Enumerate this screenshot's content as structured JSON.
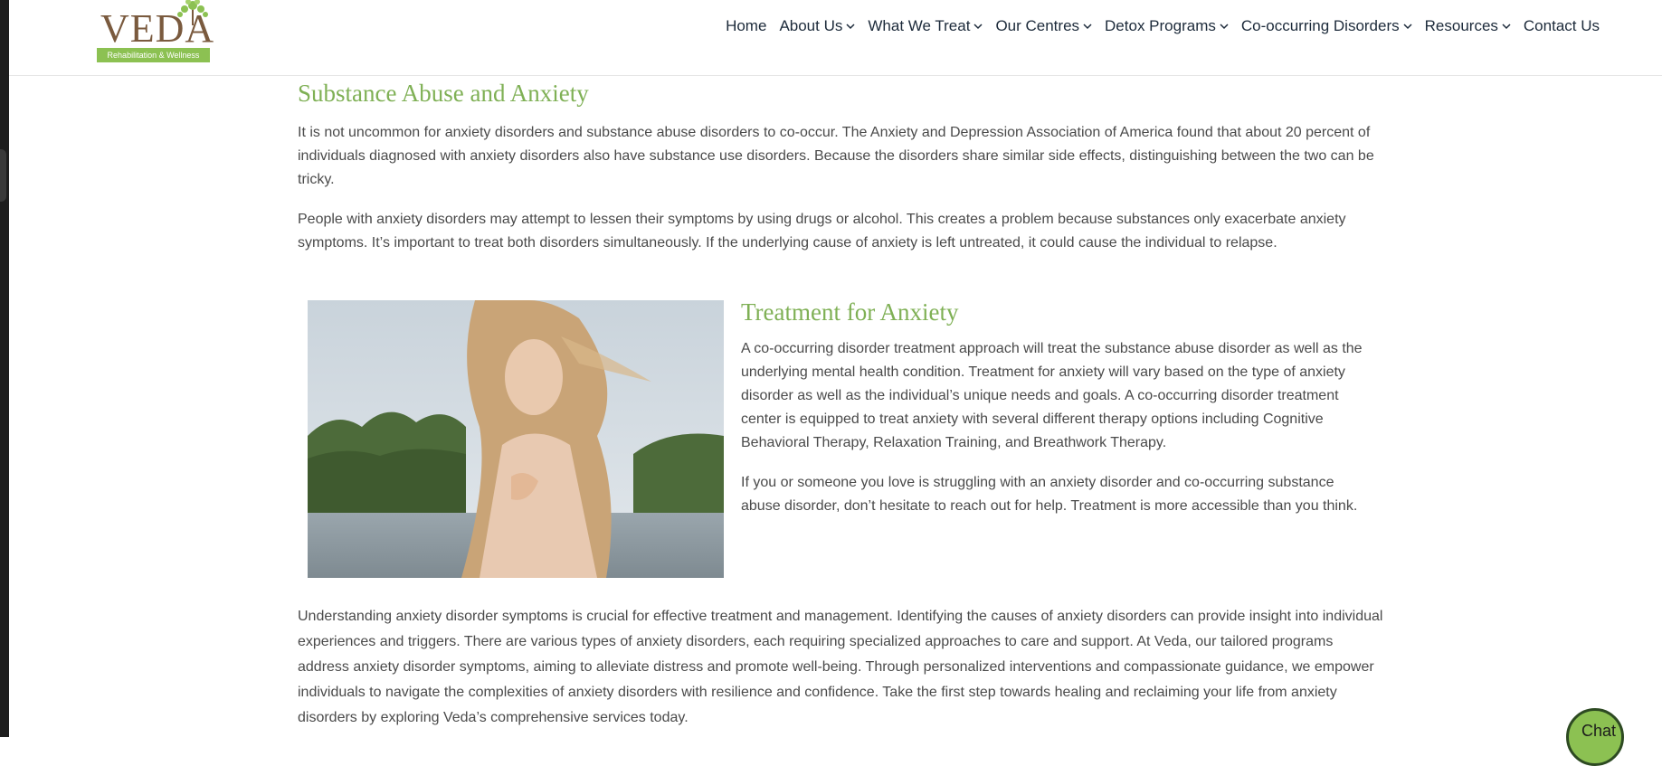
{
  "logo": {
    "word": "VEDA",
    "tagline": "Rehabilitation & Wellness"
  },
  "nav": {
    "items": [
      {
        "label": "Home",
        "dropdown": false
      },
      {
        "label": "About Us",
        "dropdown": true
      },
      {
        "label": "What We Treat",
        "dropdown": true
      },
      {
        "label": "Our Centres",
        "dropdown": true
      },
      {
        "label": "Detox Programs",
        "dropdown": true
      },
      {
        "label": "Co-occurring Disorders",
        "dropdown": true
      },
      {
        "label": "Resources",
        "dropdown": true
      },
      {
        "label": "Contact Us",
        "dropdown": false
      }
    ]
  },
  "section1": {
    "title": "Substance Abuse and Anxiety",
    "paragraphs": [
      "It is not uncommon for anxiety disorders and substance abuse disorders to co-occur. The Anxiety and Depression Association of America found that about 20 percent of individuals diagnosed with anxiety disorders also have substance use disorders. Because the disorders share similar side effects, distinguishing between the two can be tricky.",
      "People with anxiety disorders may attempt to lessen their symptoms by using drugs or alcohol. This creates a problem because substances only exacerbate anxiety symptoms. It’s important to treat both disorders simultaneously. If the underlying cause of anxiety is left untreated, it could cause the individual to relapse."
    ]
  },
  "section2": {
    "title": "Treatment for Anxiety",
    "paragraphs": [
      "A co-occurring disorder treatment approach will treat the substance abuse disorder as well as the underlying mental health condition. Treatment for anxiety will vary based on the type of anxiety disorder as well as the individual’s unique needs and goals. A co-occurring disorder treatment center is equipped to treat anxiety with several different therapy options including Cognitive Behavioral Therapy, Relaxation Training, and Breathwork Therapy.",
      "If you or someone you love is struggling with an anxiety disorder and co-occurring substance abuse disorder, don’t hesitate to reach out for help. Treatment is more accessible than you think."
    ]
  },
  "section3": {
    "paragraph": "Understanding anxiety disorder symptoms is crucial for effective treatment and management. Identifying the causes of anxiety disorders can provide insight into individual experiences and triggers. There are various types of anxiety disorders, each requiring specialized approaches to care and support. At Veda, our tailored programs address anxiety disorder symptoms, aiming to alleviate distress and promote well-being. Through personalized interventions and compassionate guidance, we empower individuals to navigate the complexities of anxiety disorders with resilience and confidence. Take the first step towards healing and reclaiming your life from anxiety disorders by exploring Veda’s comprehensive services today."
  },
  "chat": {
    "label": "Chat"
  },
  "colors": {
    "accent_green": "#7fb055",
    "brand_brown": "#7a5a3e",
    "nav_text": "#1c2a3a",
    "body_text": "#4a4a4a"
  }
}
